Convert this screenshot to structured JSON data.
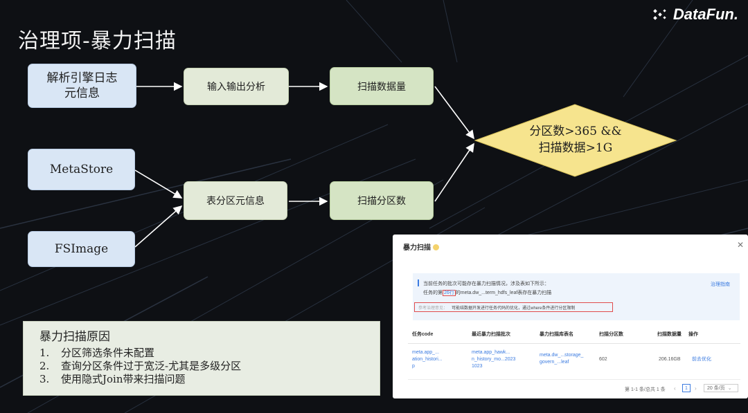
{
  "slide": {
    "title": "治理项-暴力扫描"
  },
  "logo": {
    "text": "DataFun."
  },
  "diagram": {
    "nodes": {
      "parse_engine_log": {
        "lines": [
          "解析引擎日志",
          "元信息"
        ]
      },
      "metastore": {
        "label": "MetaStore"
      },
      "fsimage": {
        "label": "FSImage"
      },
      "io_analysis": {
        "label": "输入输出分析"
      },
      "table_partition_meta": {
        "label": "表分区元信息"
      },
      "scan_data_volume": {
        "label": "扫描数据量"
      },
      "scan_partition_count": {
        "label": "扫描分区数"
      },
      "condition": {
        "lines": [
          "分区数>365 &&",
          "扫描数据>1G"
        ]
      }
    }
  },
  "reasons": {
    "title": "暴力扫描原因",
    "items": [
      {
        "num": "1.",
        "text": "分区筛选条件未配置"
      },
      {
        "num": "2.",
        "text": "查询分区条件过于宽泛-尤其是多级分区"
      },
      {
        "num": "3.",
        "text": "使用隐式Join带来扫描问题"
      }
    ]
  },
  "panel": {
    "title": "暴力扫描",
    "close_icon": "close-icon",
    "alert": {
      "line1": "当前任务的批次可能存在暴力扫描情况，涉及表如下所示：",
      "line2_prefix": "任务的第",
      "line2_count": "26行",
      "line2_suffix": "的meta.dw_...term_hdfs_leaf表存在暴力扫描",
      "link": "治理指南",
      "ref_label": "参考治理意见：",
      "ref_text": "可能结数据开发进行任务代码的优化，通过where条件进行分区限制"
    },
    "table": {
      "columns": [
        "任务code",
        "最近暴力扫描批次",
        "暴力扫描库表名",
        "扫描分区数",
        "扫描数据量",
        "操作"
      ],
      "row": {
        "task_code": [
          "meta.app_...",
          "ation_histori...",
          "p"
        ],
        "batch": [
          "meta.app_hawk...",
          "n_history_mo...2023",
          "1023"
        ],
        "table_name": [
          "meta.dw_...storage_",
          "govern_...leaf"
        ],
        "partitions": "602",
        "data_volume": "206.16GB",
        "action": "前去优化"
      }
    },
    "pagination": {
      "summary": "第 1-1 条/总共 1 条",
      "page": "1",
      "page_size": "20 条/页"
    }
  }
}
